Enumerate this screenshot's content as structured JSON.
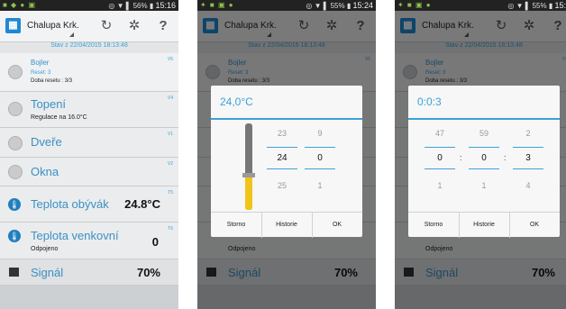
{
  "screens": [
    {
      "status_time": "15:16",
      "battery": "56%"
    },
    {
      "status_time": "15:24",
      "battery": "55%"
    },
    {
      "status_time": "15:2",
      "battery": "55%"
    }
  ],
  "app": {
    "title": "Chalupa Krk.",
    "state_line": "Stav z 22/04/2015 18:13:48",
    "icons": {
      "refresh": "refresh-icon",
      "settings": "gear-icon",
      "help": "?"
    }
  },
  "rows": [
    {
      "id": "bojler",
      "title": "Bojler",
      "sub1": "Reset: 3",
      "sub2": "Doba resetu : 3/3",
      "tag": "V5"
    },
    {
      "id": "topeni",
      "title": "Topení",
      "sub1": "Regulace na 16.0°C",
      "tag": "V4"
    },
    {
      "id": "dvere",
      "title": "Dveře",
      "tag": "V1"
    },
    {
      "id": "okna",
      "title": "Okna",
      "tag": "V2"
    },
    {
      "id": "teplota-obyvak",
      "title": "Teplota obývák",
      "value": "24.8°C",
      "tag": "T5"
    },
    {
      "id": "teplota-venkovni",
      "title": "Teplota venkovní",
      "value": "0",
      "sub1": "Odpojeno",
      "tag": "T6"
    },
    {
      "id": "signal",
      "title": "Signál",
      "value": "70%"
    }
  ],
  "dialog_temp": {
    "title": "24,0°C",
    "col1": {
      "up": "23",
      "cur": "24",
      "down": "25"
    },
    "col2": {
      "up": "9",
      "cur": "0",
      "down": "1"
    },
    "gauge_level": 0.4,
    "buttons": {
      "storno": "Storno",
      "historie": "Historie",
      "ok": "OK"
    }
  },
  "dialog_time": {
    "title": "0:0:3",
    "col1": {
      "up": "47",
      "cur": "0",
      "down": "1"
    },
    "col2": {
      "up": "59",
      "cur": "0",
      "down": "1"
    },
    "col3": {
      "up": "2",
      "cur": "3",
      "down": "4"
    },
    "separator": ":",
    "buttons": {
      "storno": "Storno",
      "historie": "Historie",
      "ok": "OK"
    }
  },
  "colors": {
    "accent": "#3aa2d8",
    "gauge_fill": "#f0c419",
    "app_icon": "#1e88d2"
  }
}
